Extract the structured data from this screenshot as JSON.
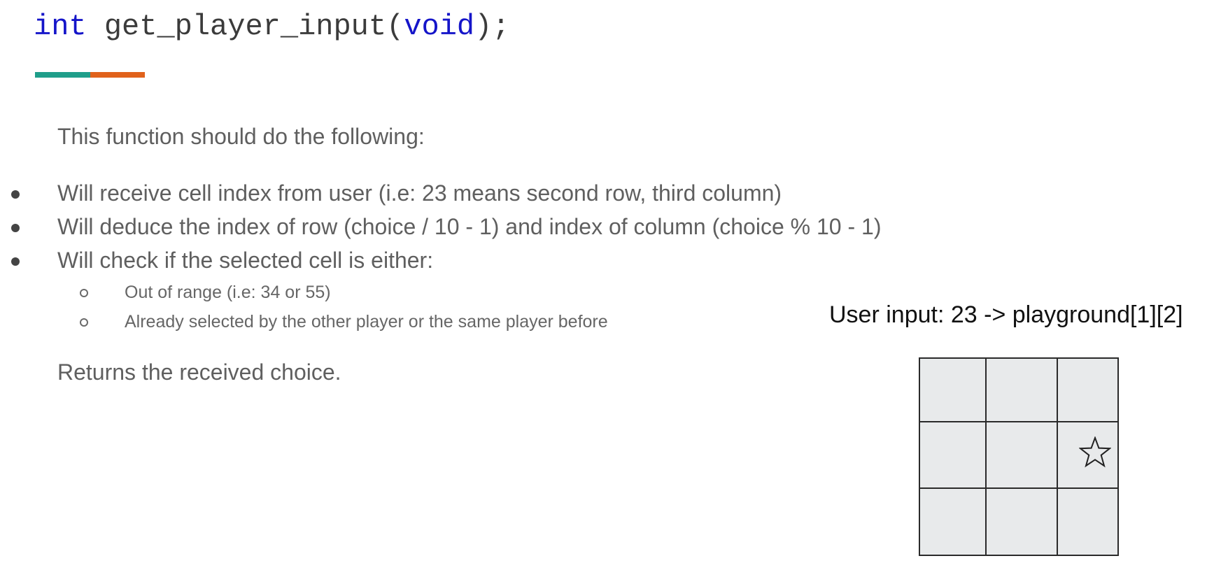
{
  "heading": {
    "return_type": "int",
    "function_name": " get_player_input(",
    "param": "void",
    "suffix": ");"
  },
  "accent_colors": {
    "teal": "#1f9e8a",
    "orange": "#e0621b",
    "keyword": "#1515c9"
  },
  "intro": "This function should do the following:",
  "bullets": [
    "Will receive cell index from user (i.e: 23 means second row, third column)",
    "Will deduce the index of row (choice / 10 - 1) and index of column (choice % 10 - 1)",
    "Will check if the selected cell is either:"
  ],
  "subbullets": [
    "Out of range (i.e: 34 or 55)",
    "Already selected by the other player or the same player before"
  ],
  "returns": "Returns the received choice.",
  "diagram": {
    "caption": "User input: 23 -> playground[1][2]",
    "rows": 3,
    "cols": 3,
    "marked_cell": {
      "row": 1,
      "col": 2,
      "icon": "star-icon"
    }
  }
}
